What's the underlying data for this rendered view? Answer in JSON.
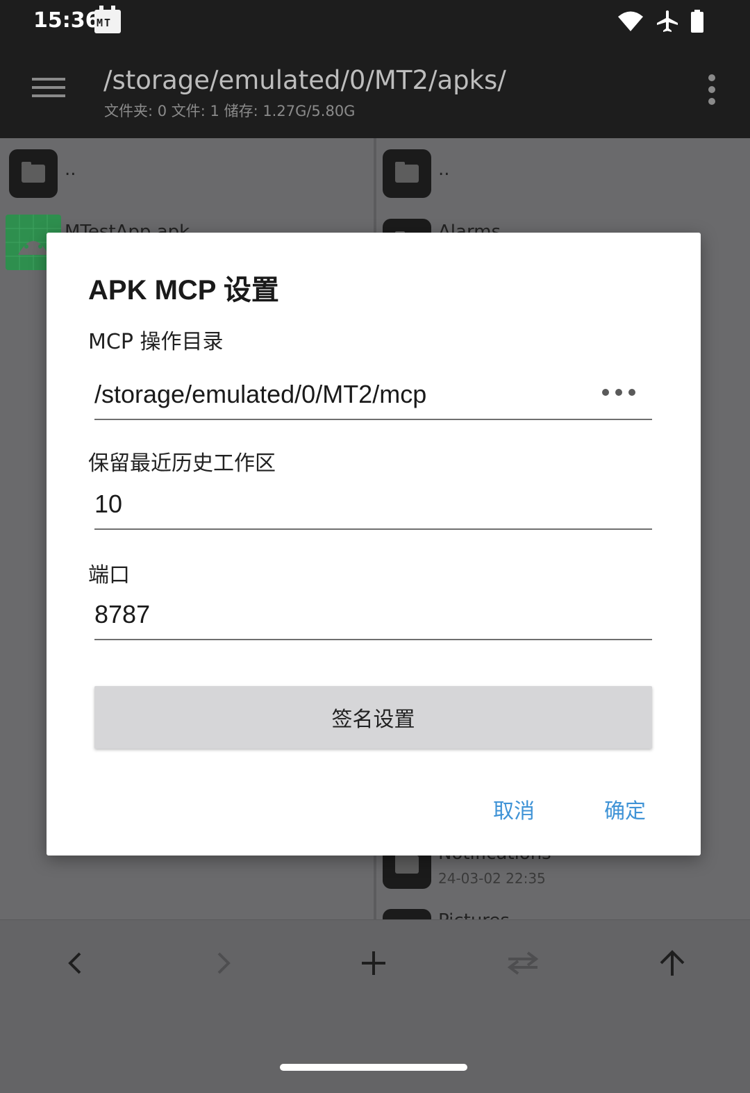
{
  "status_bar": {
    "time": "15:36",
    "app_badge": "MT",
    "icons": [
      "wifi-icon",
      "airplane-mode-icon",
      "battery-icon"
    ]
  },
  "toolbar": {
    "path": "/storage/emulated/0/MT2/apks/",
    "info": "文件夹: 0  文件: 1  储存: 1.27G/5.80G"
  },
  "left_panel": {
    "items": [
      {
        "name": "..",
        "icon": "folder-icon"
      },
      {
        "name": "MTestApp.apk",
        "icon": "android-apk-icon"
      }
    ]
  },
  "right_panel": {
    "items": [
      {
        "name": "..",
        "icon": "folder-icon"
      },
      {
        "name": "Alarms",
        "icon": "folder-icon"
      },
      {
        "name": "Notifications",
        "meta": "24-03-02 22:35",
        "icon": "folder-icon"
      },
      {
        "name": "Pictures",
        "icon": "folder-icon"
      }
    ]
  },
  "dialog": {
    "title": "APK MCP 设置",
    "dir_label": "MCP 操作目录",
    "dir_value": "/storage/emulated/0/MT2/mcp",
    "history_label": "保留最近历史工作区",
    "history_value": "10",
    "port_label": "端口",
    "port_value": "8787",
    "sign_button": "签名设置",
    "cancel": "取消",
    "confirm": "确定"
  },
  "colors": {
    "accent": "#3f93d6",
    "toolbar_bg": "#1d1d1d",
    "scrim_bg": "#6a6a6c"
  }
}
